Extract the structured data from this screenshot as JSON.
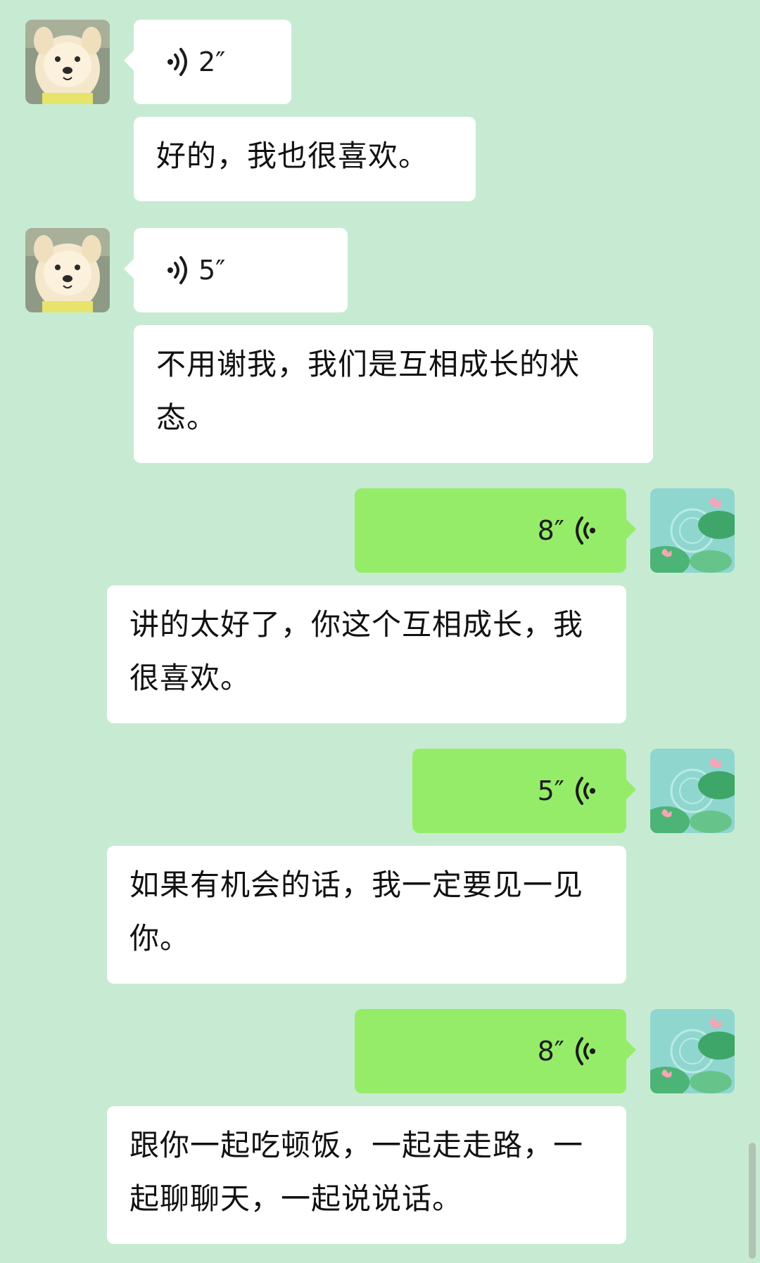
{
  "messages": [
    {
      "side": "left",
      "type": "voice",
      "duration": "2″"
    },
    {
      "side": "left",
      "type": "text",
      "text": "好的，我也很喜欢。"
    },
    {
      "side": "left",
      "type": "voice",
      "duration": "5″"
    },
    {
      "side": "left",
      "type": "text",
      "text": "不用谢我，我们是互相成长的状态。"
    },
    {
      "side": "right",
      "type": "voice",
      "duration": "8″"
    },
    {
      "side": "right",
      "type": "text",
      "text": "讲的太好了，你这个互相成长，我很喜欢。"
    },
    {
      "side": "right",
      "type": "voice",
      "duration": "5″"
    },
    {
      "side": "right",
      "type": "text",
      "text": "如果有机会的话，我一定要见一见你。"
    },
    {
      "side": "right",
      "type": "voice",
      "duration": "8″"
    },
    {
      "side": "right",
      "type": "text",
      "text": "跟你一起吃顿饭，一起走走路，一起聊聊天，一起说说话。"
    }
  ],
  "colors": {
    "background": "#c7ebd2",
    "incoming_bubble": "#ffffff",
    "outgoing_bubble": "#95ec69"
  },
  "icons": {
    "incoming_avatar": "samoyed-dog-avatar",
    "outgoing_avatar": "lotus-pond-avatar",
    "voice": "voice-wave-icon"
  }
}
